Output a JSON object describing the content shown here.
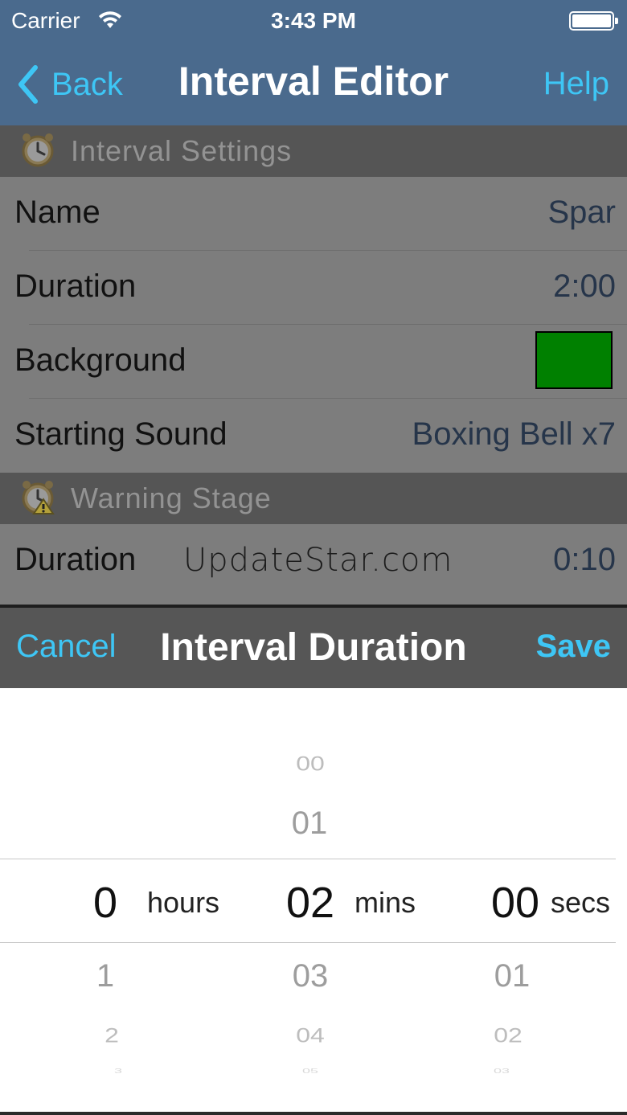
{
  "status_bar": {
    "carrier": "Carrier",
    "time": "3:43 PM"
  },
  "nav": {
    "back_label": "Back",
    "title": "Interval Editor",
    "help_label": "Help"
  },
  "interval_settings": {
    "header": "Interval Settings",
    "rows": [
      {
        "label": "Name",
        "value": "Spar"
      },
      {
        "label": "Duration",
        "value": "2:00"
      },
      {
        "label": "Background",
        "color": "#008000"
      },
      {
        "label": "Starting Sound",
        "value": "Boxing Bell x7"
      }
    ]
  },
  "warning_stage": {
    "header": "Warning Stage",
    "rows": [
      {
        "label": "Duration",
        "value": "0:10"
      }
    ]
  },
  "watermark": "UpdateStar.com",
  "picker_sheet": {
    "cancel_label": "Cancel",
    "title": "Interval Duration",
    "save_label": "Save"
  },
  "picker": {
    "hours": {
      "unit": "hours",
      "selected": "0",
      "above": [],
      "below": [
        "1",
        "2",
        "3"
      ]
    },
    "minutes": {
      "unit": "mins",
      "selected": "02",
      "above": [
        "00",
        "01"
      ],
      "below": [
        "03",
        "04",
        "05"
      ]
    },
    "seconds": {
      "unit": "secs",
      "selected": "00",
      "above": [],
      "below": [
        "01",
        "02",
        "03"
      ]
    }
  },
  "colors": {
    "nav_background": "#4a6a8d",
    "accent": "#3ec6f5",
    "background_swatch": "#008000"
  }
}
